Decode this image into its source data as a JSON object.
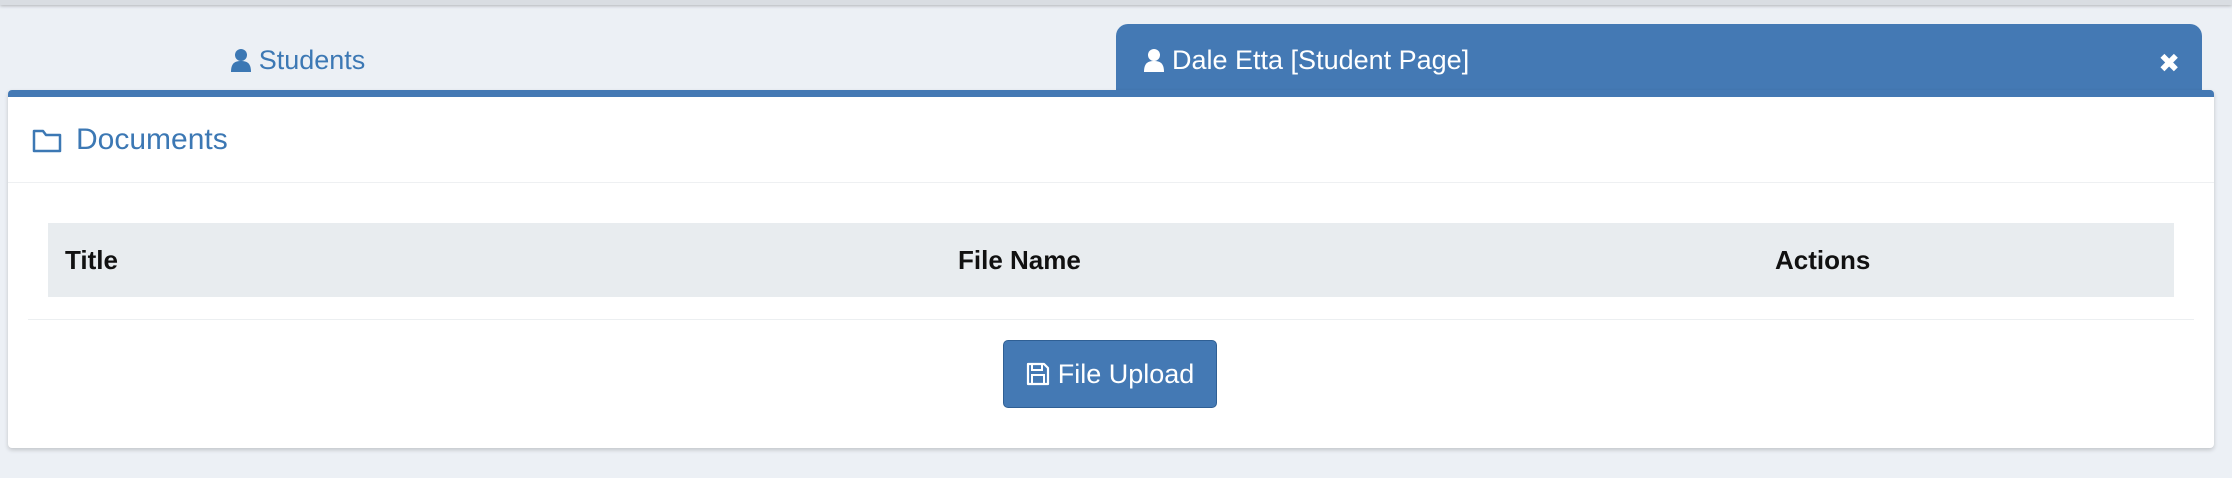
{
  "tabs": [
    {
      "label": "Students",
      "icon": "user-icon",
      "active": false
    },
    {
      "label": "Dale Etta [Student Page]",
      "icon": "user-icon",
      "active": true
    }
  ],
  "close_symbol": "✖",
  "panel": {
    "title": "Documents",
    "icon": "folder-icon"
  },
  "table": {
    "columns": [
      "Title",
      "File Name",
      "Actions"
    ]
  },
  "upload_button": {
    "label": "File Upload",
    "icon": "floppy-disk-icon"
  },
  "colors": {
    "accent": "#4479b4",
    "link": "#3c78b4",
    "background": "#ecf0f5",
    "table_header": "#e8ecef"
  }
}
